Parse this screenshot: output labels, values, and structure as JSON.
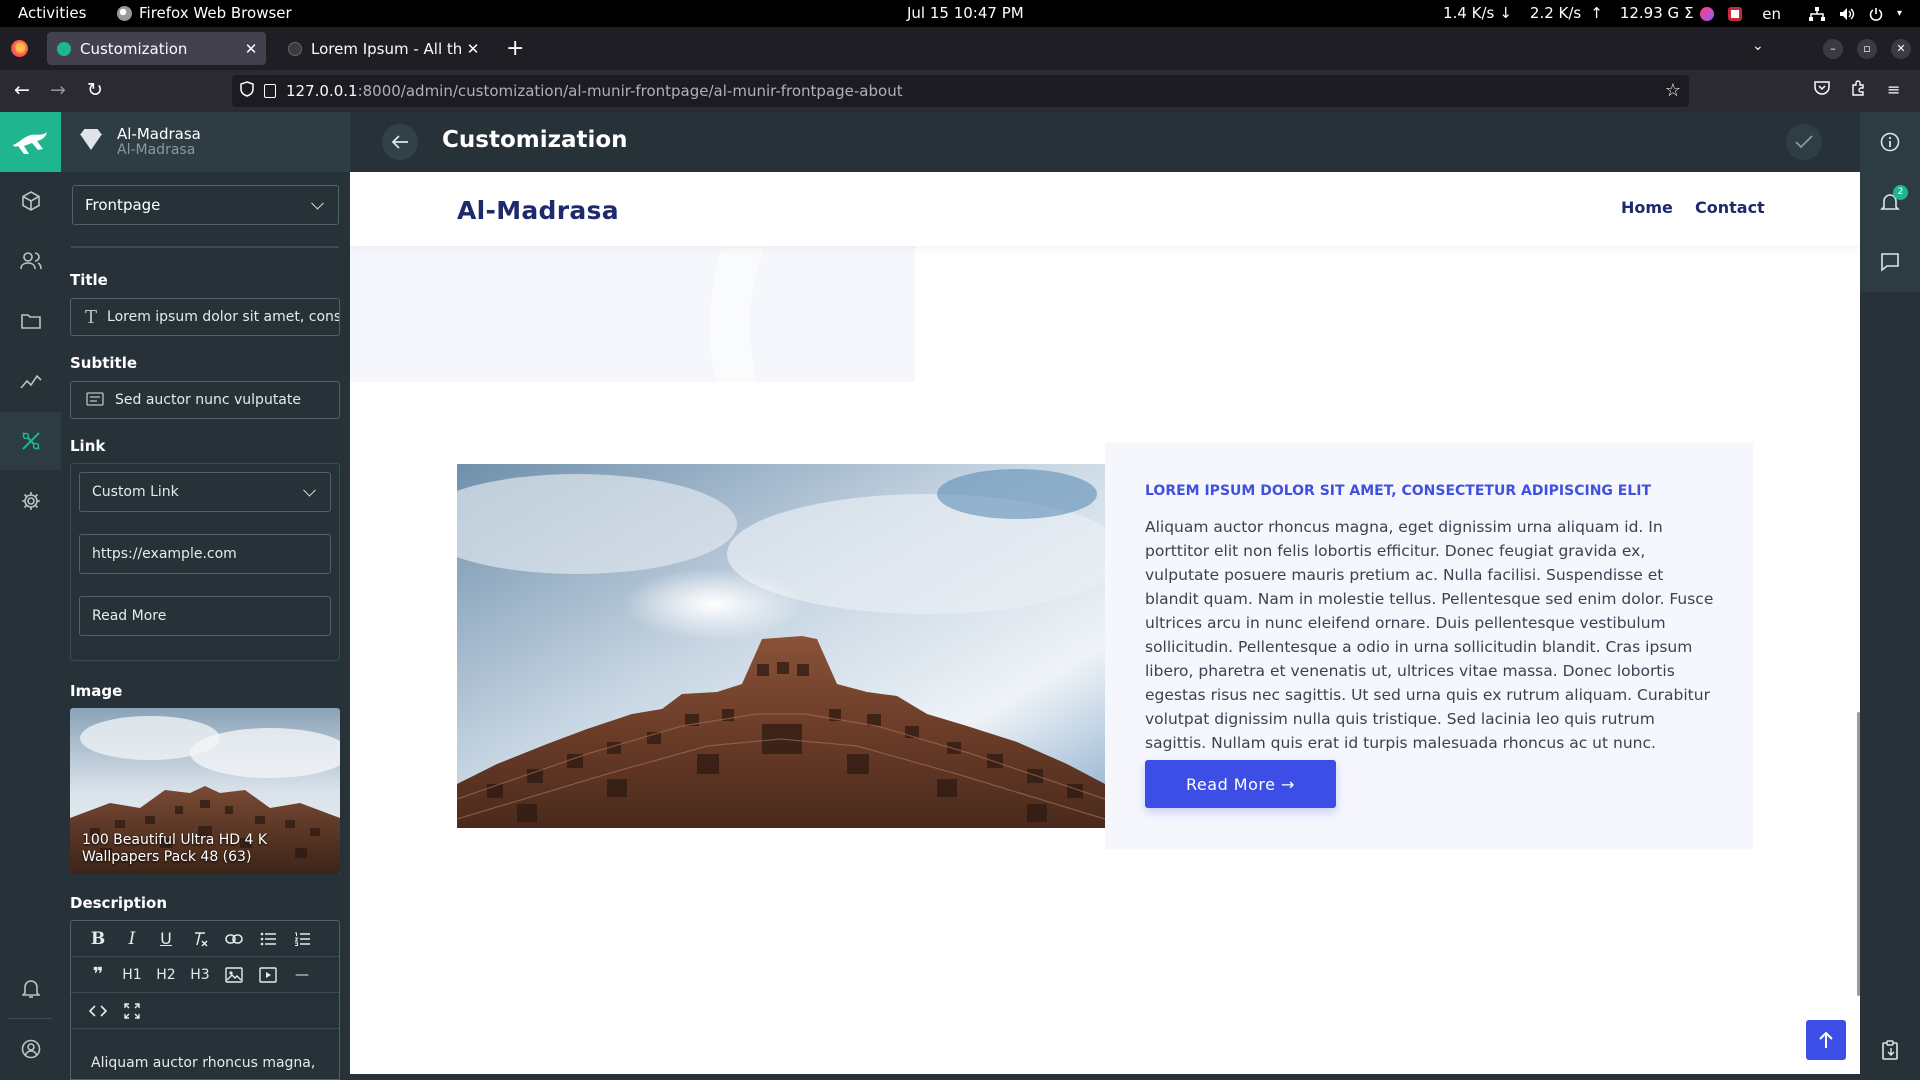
{
  "system_bar": {
    "activities": "Activities",
    "app_name": "Firefox Web Browser",
    "clock": "Jul 15  10:47 PM",
    "net_down": "1.4 K/s",
    "down_arrow": "↓",
    "net_up": "2.2 K/s",
    "up_arrow": "↑",
    "disk": "12.93 G",
    "sigma": "Σ",
    "lang": "en"
  },
  "browser": {
    "tabs": [
      {
        "title": "Customization",
        "active": true
      },
      {
        "title": "Lorem Ipsum - All the fac",
        "active": false
      }
    ],
    "new_tab": "+",
    "url_host": "127.0.0.1",
    "url_path": ":8000/admin/customization/al-munir-frontpage/al-munir-frontpage-about"
  },
  "project": {
    "name": "Al-Madrasa",
    "subtitle": "Al-Madrasa"
  },
  "panel": {
    "page_select": "Frontpage",
    "title_label": "Title",
    "title_value": "Lorem ipsum dolor sit amet, cons",
    "subtitle_label": "Subtitle",
    "subtitle_value": "Sed auctor nunc vulputate",
    "link_label": "Link",
    "link_type": "Custom Link",
    "link_url": "https://example.com",
    "link_text": "Read More",
    "image_label": "Image",
    "image_caption": "100 Beautiful Ultra HD 4 K Wallpapers Pack 48 (63)",
    "description_label": "Description",
    "toolbar_row1": [
      "B",
      "I",
      "U",
      "Tx",
      "link",
      "ul",
      "ol"
    ],
    "toolbar_row2": [
      "❞",
      "H1",
      "H2",
      "H3",
      "image",
      "video",
      "—"
    ],
    "toolbar_row3": [
      "</>",
      "fullscreen"
    ],
    "description_preview": "Aliquam auctor rhoncus magna,"
  },
  "app_header": {
    "title": "Customization"
  },
  "right_rail": {
    "notification_count": "2"
  },
  "site": {
    "logo": "Al-Madrasa",
    "nav": [
      "Home",
      "Contact"
    ],
    "about": {
      "kicker": "LOREM IPSUM DOLOR SIT AMET, CONSECTETUR ADIPISCING ELIT",
      "body": "Aliquam auctor rhoncus magna, eget dignissim urna aliquam id. In porttitor elit non felis lobortis efficitur. Donec feugiat gravida ex, vulputate posuere mauris pretium ac. Nulla facilisi. Suspendisse et blandit quam. Nam in molestie tellus. Pellentesque sed enim dolor. Fusce ultrices arcu in nunc eleifend ornare. Duis pellentesque vestibulum sollicitudin. Pellentesque a odio in urna sollicitudin blandit. Cras ipsum libero, pharetra et venenatis ut, ultrices vitae massa. Donec lobortis egestas risus nec sagittis. Ut sed urna quis ex rutrum aliquam. Curabitur volutpat dignissim nulla quis tristique. Sed lacinia leo quis rutrum sagittis. Nullam quis erat id turpis malesuada rhoncus ac ut nunc.",
      "button": "Read More →"
    }
  },
  "colors": {
    "brand_green": "#1fb58e",
    "sidebar_bg": "#263238",
    "site_primary": "#3d4ee6",
    "site_navy": "#1e2a6e"
  },
  "icons": [
    "firefox-icon",
    "shield-icon",
    "star-icon",
    "pocket-icon",
    "extensions-icon",
    "menu-icon",
    "cube-icon",
    "users-icon",
    "folder-icon",
    "chart-icon",
    "customize-icon",
    "gear-icon",
    "bell-icon",
    "user-circle-icon",
    "info-icon",
    "chat-icon",
    "clipboard-icon",
    "arrow-up-icon",
    "back-arrow-icon",
    "check-icon"
  ]
}
